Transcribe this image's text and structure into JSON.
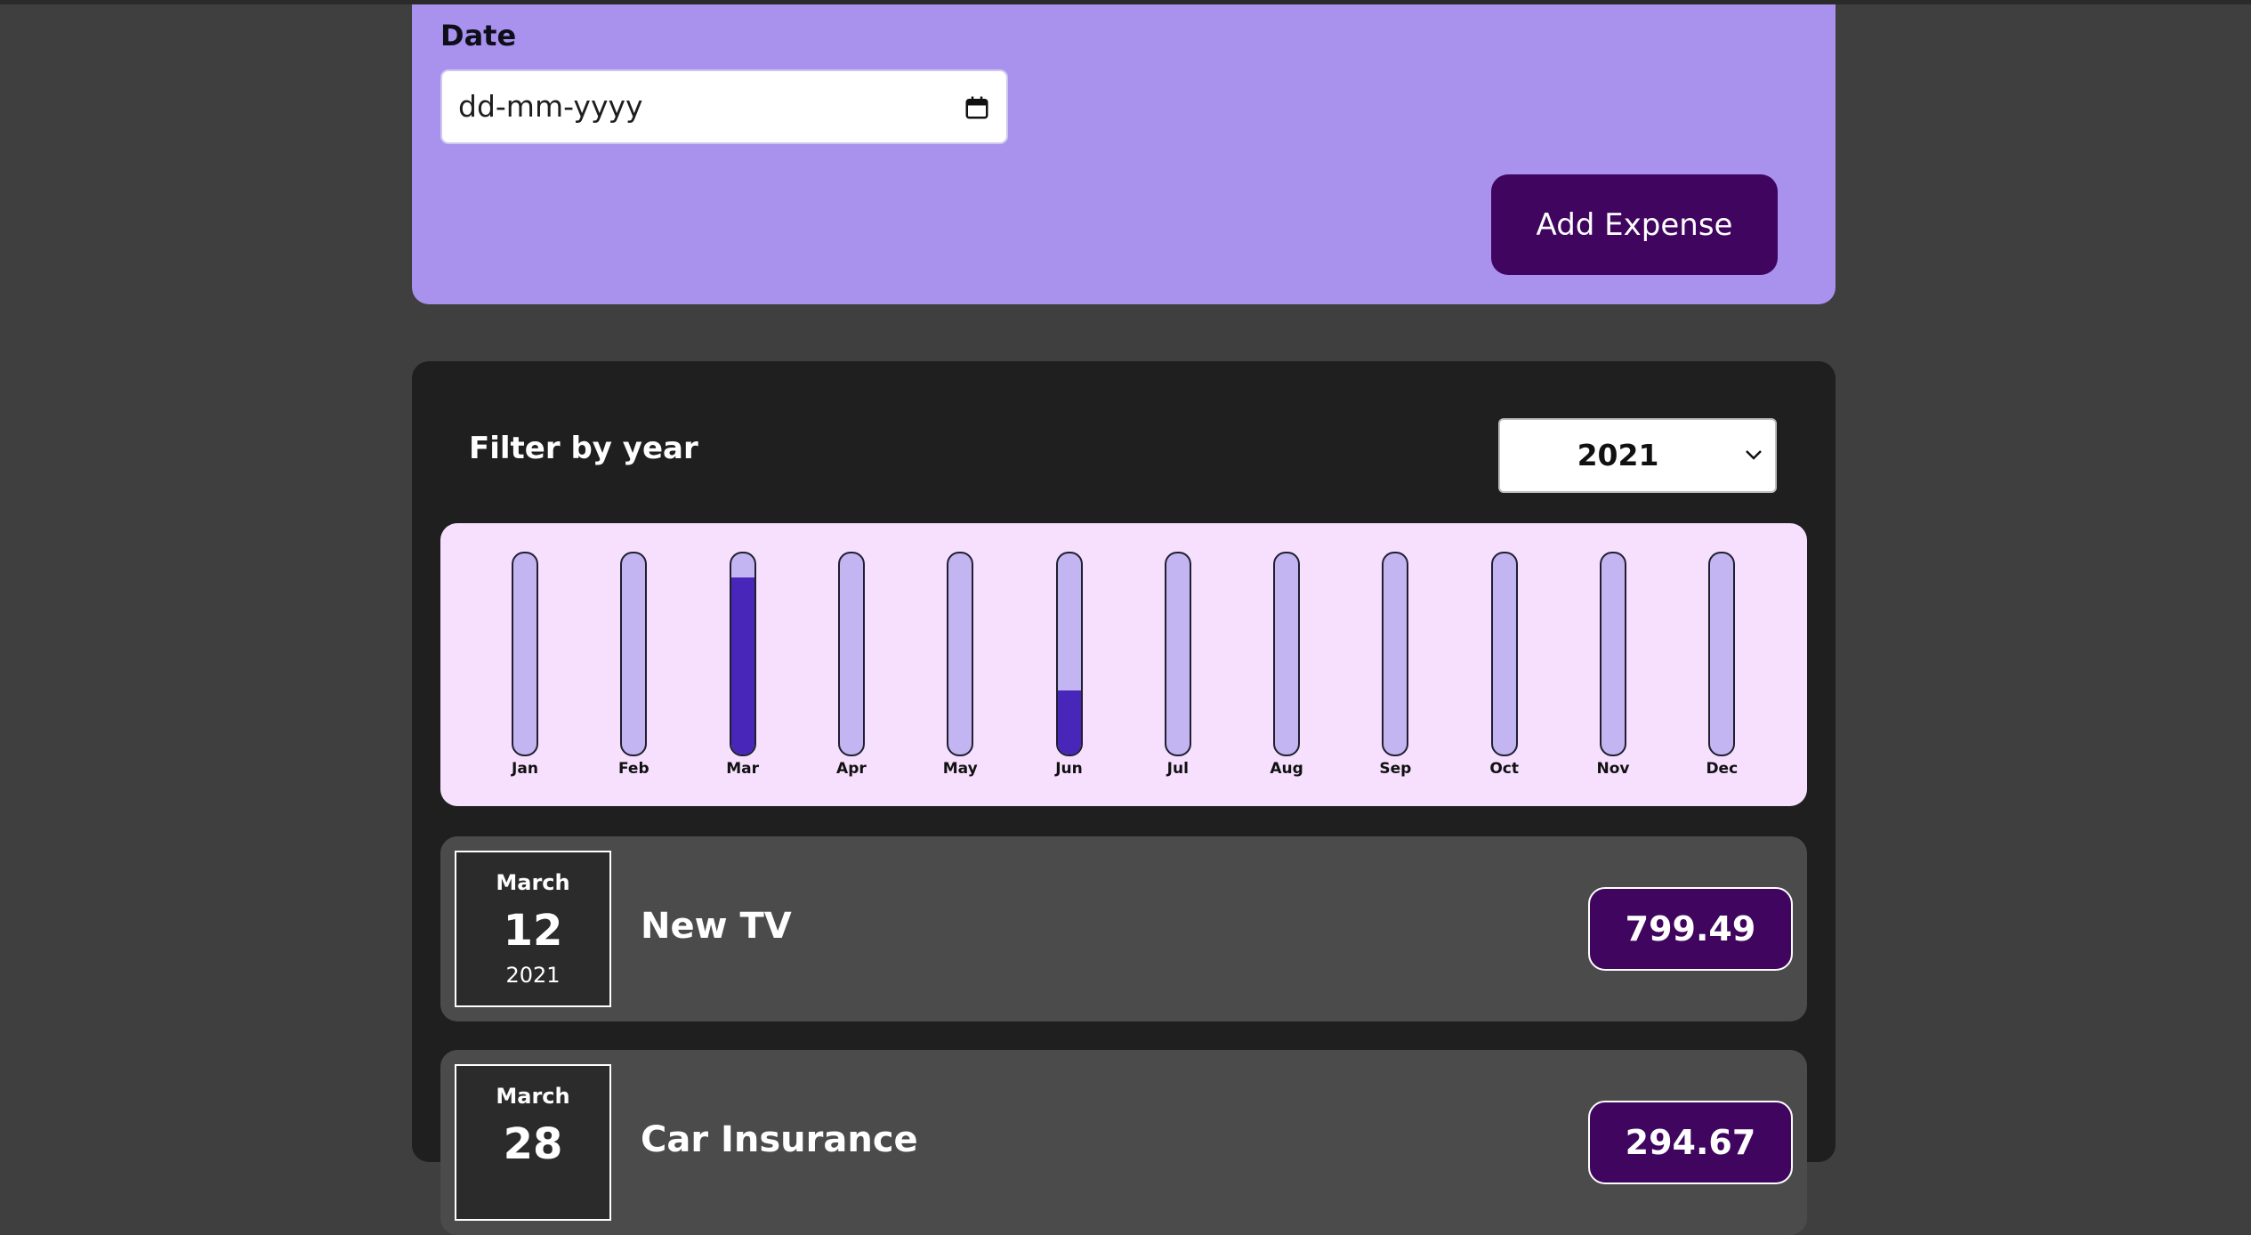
{
  "form": {
    "date_label": "Date",
    "date_placeholder": "dd-mm-yyyy",
    "add_button_label": "Add Expense"
  },
  "filter": {
    "label": "Filter by year",
    "selected_year": "2021"
  },
  "chart_data": {
    "type": "bar",
    "categories": [
      "Jan",
      "Feb",
      "Mar",
      "Apr",
      "May",
      "Jun",
      "Jul",
      "Aug",
      "Sep",
      "Oct",
      "Nov",
      "Dec"
    ],
    "values": [
      0,
      0,
      0.88,
      0,
      0,
      0.32,
      0,
      0,
      0,
      0,
      0,
      0
    ],
    "ylim": [
      0,
      1
    ]
  },
  "expenses": [
    {
      "month": "March",
      "day": "12",
      "year": "2021",
      "title": "New TV",
      "amount": "799.49"
    },
    {
      "month": "March",
      "day": "28",
      "year": "",
      "title": "Car Insurance",
      "amount": "294.67"
    }
  ],
  "colors": {
    "form_bg": "#a892ee",
    "button_bg": "#40055e",
    "bar_fill": "#4826b9",
    "bar_empty": "#c3b4f2",
    "chart_bg": "#f7e0fe"
  }
}
